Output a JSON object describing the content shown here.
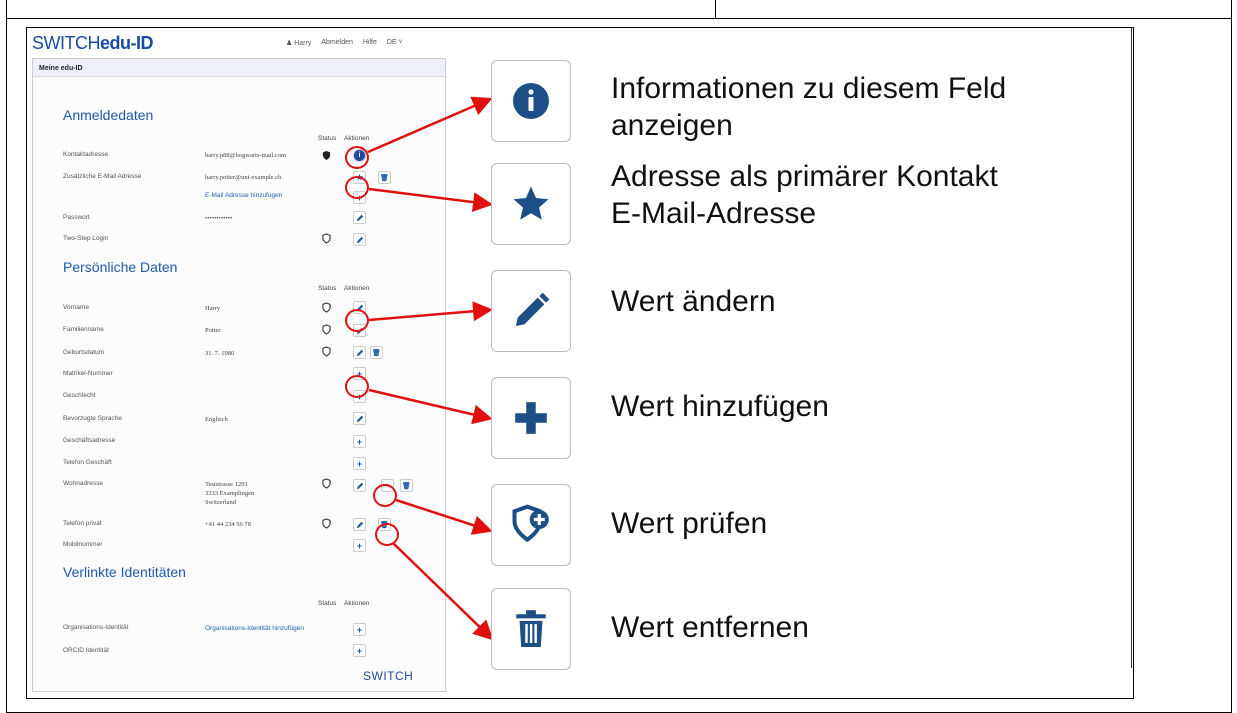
{
  "app": {
    "logo": {
      "part1": "SWITCH",
      "part2": "edu-ID"
    },
    "nav": {
      "user": "Harry",
      "logout": "Abmelden",
      "help": "Hilfe",
      "lang": "DE"
    },
    "panel_title": "Meine edu-ID",
    "col_status": "Status",
    "col_actions": "Aktionen",
    "footer_brand": "SWITCH",
    "sections": [
      {
        "title": "Anmeldedaten",
        "rows": [
          {
            "label": "Kontaktadresse",
            "value": "harry.p88@hogwarts-mail.com"
          },
          {
            "label": "Zusätzliche E-Mail Adresse",
            "value": "harry.potter@uni-example.ch"
          },
          {
            "label": "",
            "value": "E-Mail Adresse hinzufügen"
          },
          {
            "label": "Passwort",
            "value": "••••••••••••"
          },
          {
            "label": "Two-Step Login",
            "value": ""
          }
        ]
      },
      {
        "title": "Persönliche Daten",
        "rows": [
          {
            "label": "Vorname",
            "value": "Harry"
          },
          {
            "label": "Familienname",
            "value": "Potter"
          },
          {
            "label": "Geburtsdatum",
            "value": "31. 7. 1980"
          },
          {
            "label": "Matrikel-Nummer",
            "value": ""
          },
          {
            "label": "Geschlecht",
            "value": ""
          },
          {
            "label": "Bevorzugte Sprache",
            "value": "Englisch"
          },
          {
            "label": "Geschäftsadresse",
            "value": ""
          },
          {
            "label": "Telefon Geschäft",
            "value": ""
          },
          {
            "label": "Wohnadresse",
            "value": "Teststrasse 1291",
            "value2": "3333 Examplingen",
            "value3": "Switzerland"
          },
          {
            "label": "Telefon privat",
            "value": "+41 44 234 56 78"
          },
          {
            "label": "Mobilnummer",
            "value": ""
          }
        ]
      },
      {
        "title": "Verlinkte Identitäten",
        "rows": [
          {
            "label": "Organisations-Identität",
            "value": "Organisations-Identität hinzufügen"
          },
          {
            "label": "ORCID Identität",
            "value": ""
          }
        ]
      }
    ]
  },
  "legend": [
    {
      "icon": "info-icon",
      "line1": "Informationen zu diesem Feld",
      "line2": "anzeigen"
    },
    {
      "icon": "star-icon",
      "line1": "Adresse als primärer Kontakt",
      "line2": "E-Mail-Adresse"
    },
    {
      "icon": "pencil-icon",
      "line1": "Wert ändern",
      "line2": ""
    },
    {
      "icon": "plus-icon",
      "line1": "Wert hinzufügen",
      "line2": ""
    },
    {
      "icon": "shield-plus-icon",
      "line1": "Wert prüfen",
      "line2": ""
    },
    {
      "icon": "trash-icon",
      "line1": "Wert entfernen",
      "line2": ""
    }
  ],
  "colors": {
    "accent": "#1e5aa8",
    "arrow": "#e01010"
  }
}
